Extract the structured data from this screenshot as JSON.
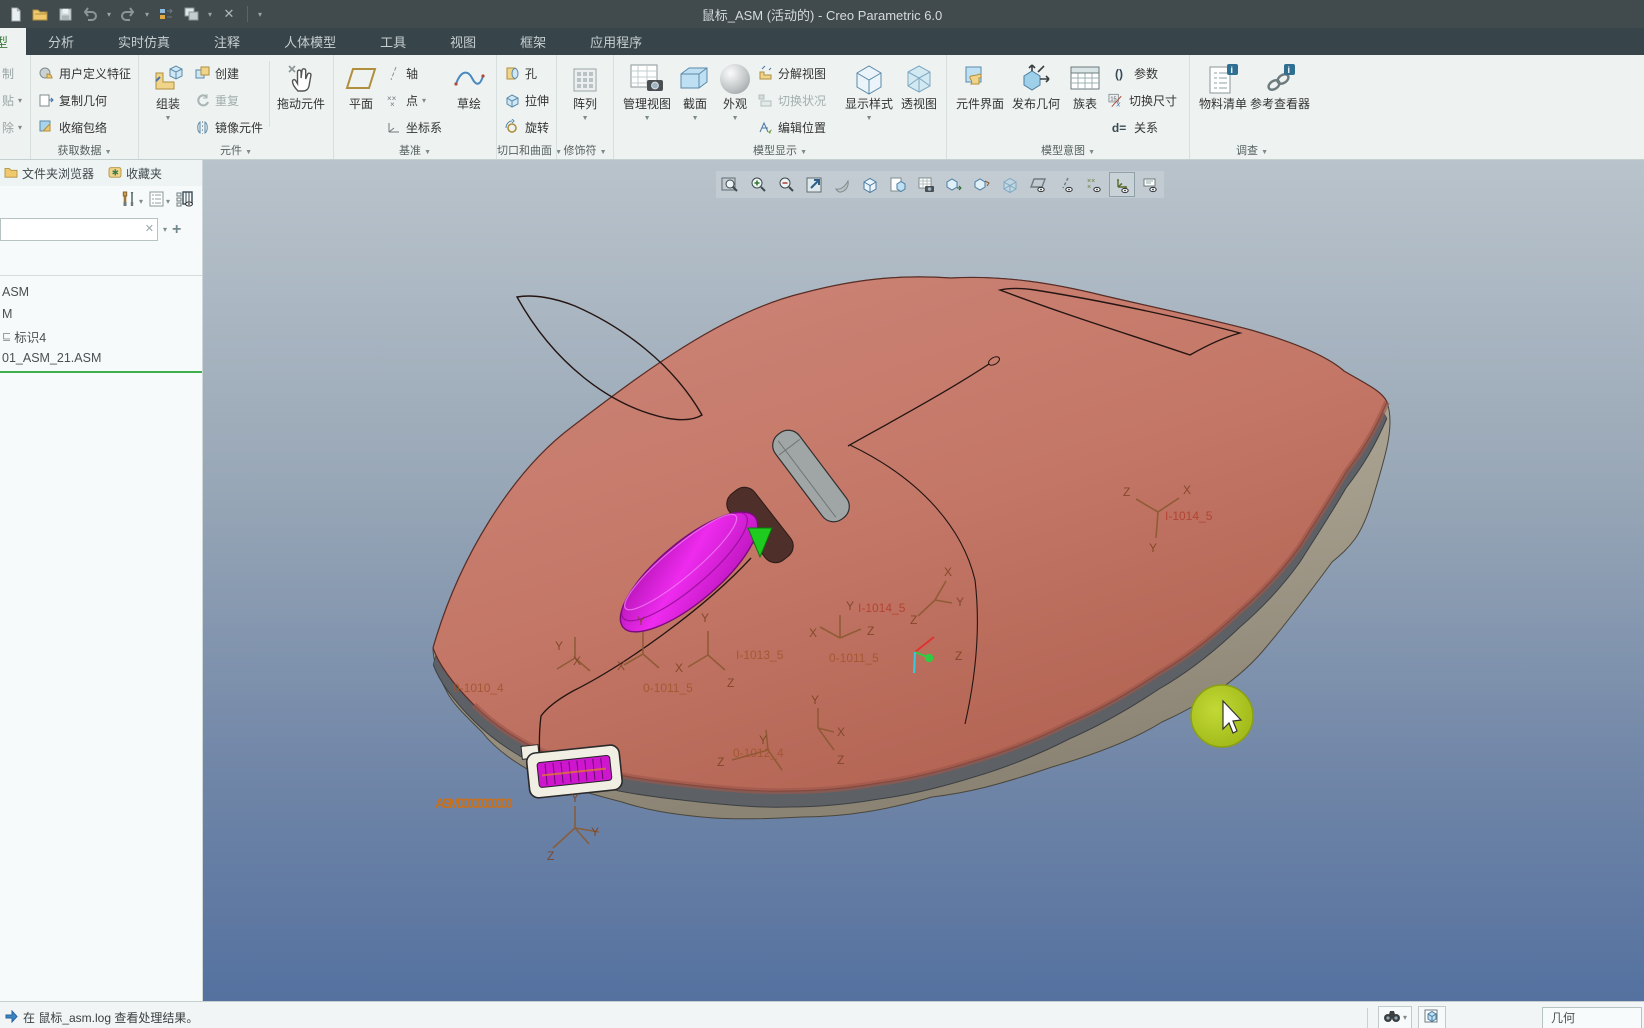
{
  "window": {
    "title": "鼠标_ASM (活动的) - Creo Parametric 6.0"
  },
  "qat": {
    "icons": [
      "new-file",
      "open-file",
      "save",
      "undo",
      "redo",
      "regenerate",
      "window-views",
      "close"
    ]
  },
  "tabs": {
    "items": [
      "模型",
      "分析",
      "实时仿真",
      "注释",
      "人体模型",
      "工具",
      "视图",
      "框架",
      "应用程序"
    ],
    "active": "模型"
  },
  "ribbon": {
    "clipped_items": [
      "制",
      "贴",
      "除"
    ],
    "groups": [
      {
        "label": "获取数据",
        "items": [
          "用户定义特征",
          "复制几何",
          "收缩包络"
        ]
      },
      {
        "label": "元件",
        "assemble": "组装",
        "items": [
          "创建",
          "重复",
          "镜像元件"
        ],
        "drag": "拖动元件"
      },
      {
        "label": "基准",
        "plane": "平面",
        "items": [
          "轴",
          "点",
          "坐标系"
        ],
        "sketch": "草绘"
      },
      {
        "label": "切口和曲面",
        "items": [
          "孔",
          "拉伸",
          "旋转"
        ]
      },
      {
        "label": "修饰符",
        "pattern": "阵列"
      },
      {
        "label": "模型显示",
        "big": [
          "管理视图",
          "截面",
          "外观"
        ],
        "items": [
          "分解视图",
          "切换状况",
          "编辑位置"
        ],
        "big2": [
          "显示样式",
          "透视图"
        ]
      },
      {
        "label": "模型意图",
        "big": [
          "元件界面",
          "发布几何",
          "族表"
        ],
        "items": [
          "参数",
          "切换尺寸",
          "关系"
        ],
        "prefix1": "()",
        "prefix3": "d="
      },
      {
        "label": "调查",
        "big": [
          "物料清单",
          "参考查看器"
        ]
      }
    ]
  },
  "sidebar": {
    "tabs": [
      "文件夹浏览器",
      "收藏夹"
    ],
    "search_value": "",
    "tree": [
      "ASM",
      "M",
      "标识4",
      "01_ASM_21.ASM"
    ]
  },
  "viewport": {
    "toolbar_icons": [
      "zoom-region",
      "zoom-in",
      "zoom-out",
      "refit",
      "repaint",
      "display-style",
      "saved-views",
      "view-manager",
      "capture-view",
      "view-orientation",
      "transparent-style",
      "datum-plane-toggle",
      "datum-axis-toggle",
      "datum-point-toggle",
      "datum-csys-toggle",
      "annotation-toggle"
    ],
    "active_toolbar_icon": "datum-csys-toggle",
    "ax": {
      "x": "X",
      "y": "Y",
      "z": "Z"
    },
    "csys": {
      "n1013": "I-1013_5",
      "n1011a": "0-1011_5",
      "n1011b": "0-1011_5",
      "n1010": "0-1010_4",
      "n1012": "0-1012_4",
      "n1014a": "I-1014_5",
      "n1014b": "I-1014_5",
      "asm_stack": "ASM00000000000"
    }
  },
  "status": {
    "message": "在 鼠标_asm.log 查看处理结果。",
    "selection_filter": "几何"
  }
}
